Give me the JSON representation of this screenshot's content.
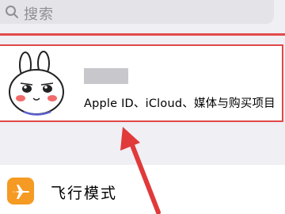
{
  "search": {
    "placeholder": "搜索",
    "icon": "search-icon"
  },
  "profile": {
    "subtitle": "Apple ID、iCloud、媒体与购买项目",
    "avatar": "cartoon-rabbit-avatar"
  },
  "settings": {
    "rows": [
      {
        "label": "飞行模式",
        "icon": "airplane-icon",
        "icon_color": "#f59a23"
      }
    ]
  },
  "annotation": {
    "color": "#e03a3a"
  }
}
